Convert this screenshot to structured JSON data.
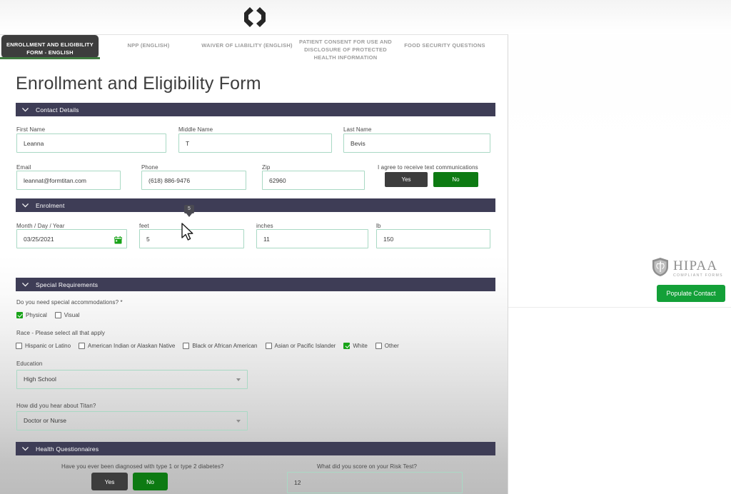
{
  "app": {
    "logo_icon": "chevron-brackets-logo"
  },
  "tabs": [
    {
      "label": "ENROLLMENT AND ELIGIBILITY FORM - ENGLISH",
      "active": true
    },
    {
      "label": "NPP (ENGLISH)",
      "active": false
    },
    {
      "label": "WAIVER OF LIABILITY (ENGLISH)",
      "active": false
    },
    {
      "label": "PATIENT CONSENT FOR USE AND DISCLOSURE OF PROTECTED HEALTH INFORMATION",
      "active": false
    },
    {
      "label": "FOOD SECURITY QUESTIONS",
      "active": false
    }
  ],
  "form": {
    "title": "Enrollment and Eligibility Form",
    "sections": {
      "contact_details": {
        "header": "Contact Details",
        "fields": {
          "first_name_label": "First Name",
          "first_name_value": "Leanna",
          "middle_name_label": "Middle Name",
          "middle_name_value": "T",
          "last_name_label": "Last Name",
          "last_name_value": "Bevis",
          "email_label": "Email",
          "email_value": "leannat@formtitan.com",
          "phone_label": "Phone",
          "phone_value": "(618) 886-9476",
          "zip_label": "Zip",
          "zip_value": "62960",
          "consent_label": "I agree to receive text communications",
          "consent_yes": "Yes",
          "consent_no": "No"
        }
      },
      "enrolment": {
        "header": "Enrolment",
        "fields": {
          "dob_label": "Month / Day / Year",
          "dob_value": "03/25/2021",
          "feet_label": "feet",
          "feet_value": "5",
          "inches_label": "inches",
          "inches_value": "11",
          "lb_label": "lb",
          "lb_value": "150"
        },
        "tooltip": "5"
      },
      "special_requirements": {
        "header": "Special Requirements",
        "accommodations_question": "Do you need special accommodations? *",
        "accommodations_options": [
          {
            "label": "Physical",
            "checked": true
          },
          {
            "label": "Visual",
            "checked": false
          }
        ],
        "race_question": "Race - Please select all that apply",
        "race_options": [
          {
            "label": "Hispanic or Latino",
            "checked": false
          },
          {
            "label": "American Indian or Alaskan Native",
            "checked": false
          },
          {
            "label": "Black or African American",
            "checked": false
          },
          {
            "label": "Asian or Pacific Islander",
            "checked": false
          },
          {
            "label": "White",
            "checked": true
          },
          {
            "label": "Other",
            "checked": false
          }
        ],
        "education_label": "Education",
        "education_value": "High School",
        "referral_label": "How did you hear about Titan?",
        "referral_value": "Doctor or Nurse"
      },
      "health_questionnaires": {
        "header": "Health Questionnaires",
        "diabetes_question": "Have you ever been diagnosed with type 1 or type 2 diabetes?",
        "diabetes_yes": "Yes",
        "diabetes_no": "No",
        "risk_test_question": "What did you score on your Risk Test?",
        "risk_test_value": "12"
      }
    }
  },
  "rail": {
    "hipaa_main": "HIPAA",
    "hipaa_sub": "COMPLIANT FORMS",
    "hipaa_icon": "shield-caduceus-icon",
    "populate_button": "Populate Contact"
  },
  "colors": {
    "section_header": "#3e3d56",
    "active_tab": "#3d3d3d",
    "accent_green": "#0d7a12",
    "populate_green": "#13a038",
    "field_border": "#a9d9c4",
    "tab_underline": "#3f7a3f"
  }
}
